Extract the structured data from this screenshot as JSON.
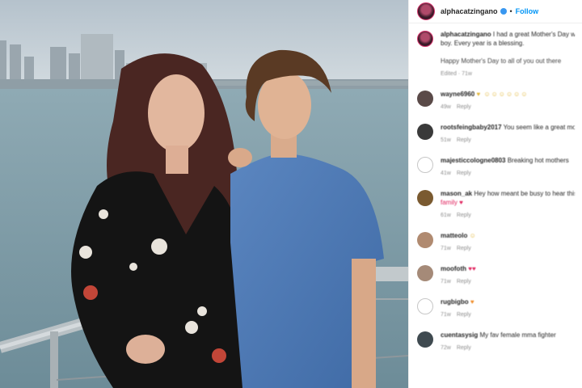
{
  "post": {
    "username": "alphacatzingano",
    "follow_label": "Follow",
    "separator": "•",
    "caption": {
      "username": "alphacatzingano",
      "text": "I had a great Mother's Day w…",
      "line2": "boy. Every year is a blessing.",
      "line3": "Happy Mother's Day to all of you out there",
      "time": "Edited · 71w"
    }
  },
  "comments": [
    {
      "username": "wayne6960",
      "text": "♥ ☺☺☺☺☺☺",
      "time": "49w",
      "reply": "Reply",
      "avatar_color": "#5a4a48"
    },
    {
      "username": "rootsfeingbaby2017",
      "text": "You seem like a great mother",
      "time": "51w",
      "reply": "Reply",
      "avatar_color": "#3a3a3a"
    },
    {
      "username": "majesticcologne0803",
      "text": "Breaking hot mothers",
      "time": "41w",
      "reply": "Reply",
      "avatar_color": "#ffffff"
    },
    {
      "username": "mason_ak",
      "text": "Hey how meant be busy to hear this",
      "text2": "family ♥",
      "time": "61w",
      "reply": "Reply",
      "avatar_color": "#7a5a30"
    },
    {
      "username": "matteolo",
      "text": "☺",
      "time": "71w",
      "reply": "Reply",
      "avatar_color": "#b08a70"
    },
    {
      "username": "moofoth",
      "text": "♥♥",
      "time": "71w",
      "reply": "Reply",
      "avatar_color": "#a58a78"
    },
    {
      "username": "rugbigbo",
      "text": "♥",
      "time": "71w",
      "reply": "Reply",
      "avatar_color": "#ffffff"
    },
    {
      "username": "cuentasysig",
      "text": "My fav female mma fighter",
      "time": "72w",
      "reply": "Reply",
      "avatar_color": "#3f4a50"
    }
  ]
}
